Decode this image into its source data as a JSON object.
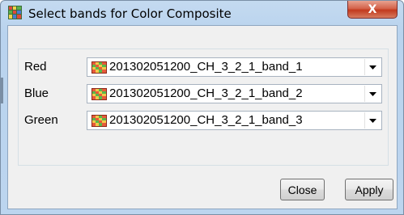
{
  "window": {
    "title": "Select bands for Color Composite",
    "close_glyph": "X"
  },
  "bands": [
    {
      "label": "Red",
      "value": "201302051200_CH_3_2_1_band_1",
      "icon": "raster-band-icon"
    },
    {
      "label": "Blue",
      "value": "201302051200_CH_3_2_1_band_2",
      "icon": "raster-band-icon"
    },
    {
      "label": "Green",
      "value": "201302051200_CH_3_2_1_band_3",
      "icon": "raster-band-icon"
    }
  ],
  "buttons": {
    "close_label": "Close",
    "apply_label": "Apply"
  },
  "colors": {
    "titlebar": "#b9d3ee",
    "close_button": "#c23a1e",
    "client_background": "#f0f0f0"
  }
}
